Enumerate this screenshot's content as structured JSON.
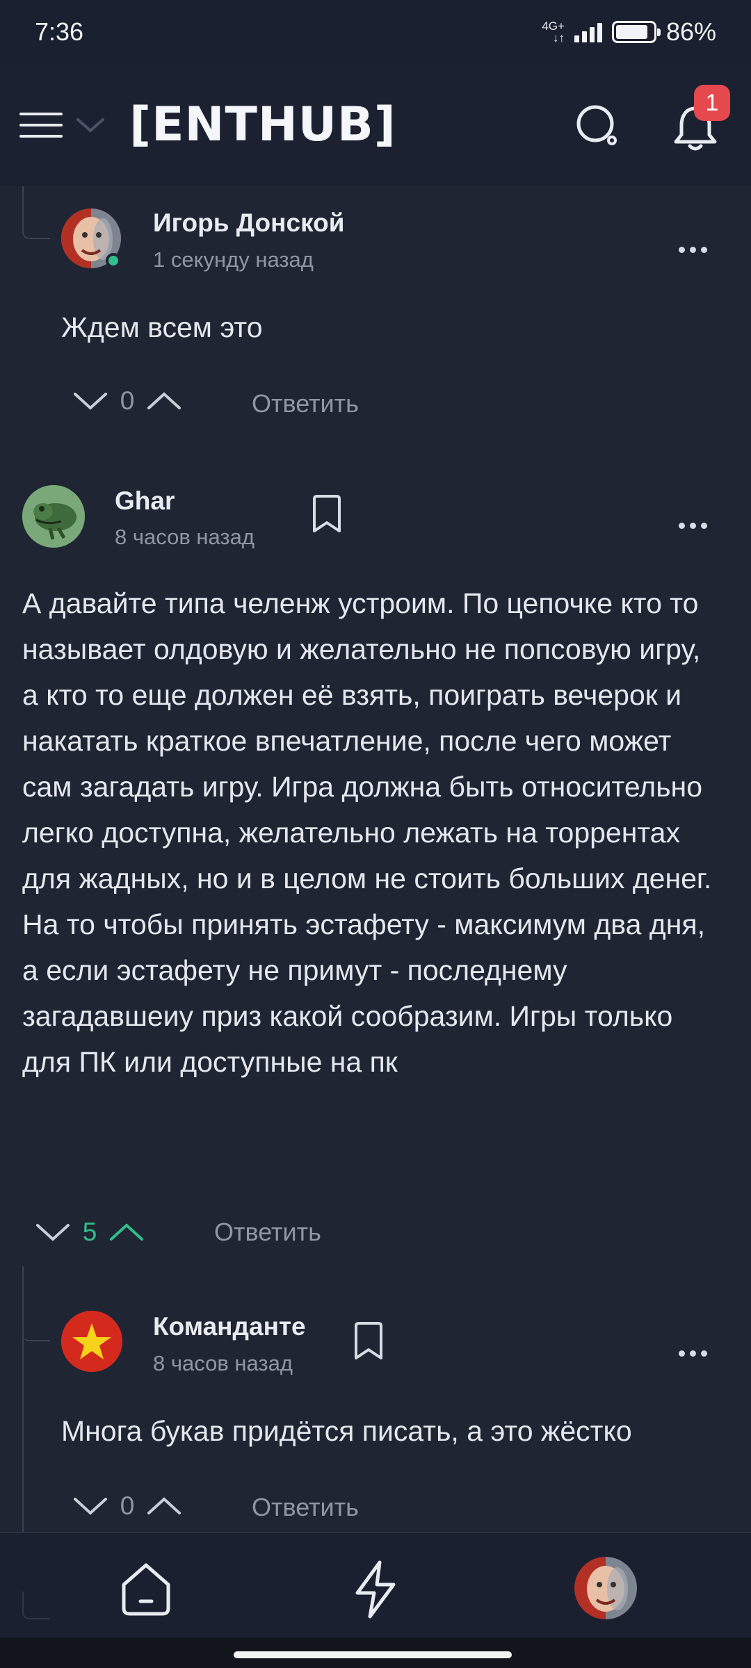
{
  "status": {
    "time": "7:36",
    "network_top": "4G+",
    "network_bottom": "↓↑",
    "battery_percent": "86%",
    "battery_level": 0.86
  },
  "header": {
    "brand": "[ENTHUB]",
    "notification_count": "1"
  },
  "comments": [
    {
      "author": "Игорь Донской",
      "time": "1 секунду назад",
      "text": "Ждем всем это",
      "votes": "0",
      "reply_label": "Ответить"
    },
    {
      "author": "Ghar",
      "time": "8 часов назад",
      "text": "А давайте типа челенж устроим. По цепочке кто то называет олдовую и желательно не попсовую игру, а кто то еще должен её взять, поиграть вечерок и накатать краткое впечатление, после чего может сам загадать игру. Игра должна быть относительно легко доступна, желательно лежать на торрентах для жадных, но и в целом не стоить больших денег. На то чтобы принять эстафету - максимум два дня, а если эстафету не примут - последнему загадавшеиу приз какой сообразим. Игры только для ПК или доступные на пк",
      "votes": "5",
      "reply_label": "Ответить"
    },
    {
      "author": "Команданте",
      "time": "8 часов назад",
      "text": "Многа букав придётся писать, а это жёстко",
      "votes": "0",
      "reply_label": "Ответить"
    }
  ],
  "colors": {
    "accent_green": "#2fbf8a",
    "badge_red": "#e5484d",
    "background": "#1f2533"
  },
  "icons": [
    "menu-icon",
    "chevron-down-icon",
    "search-icon",
    "bell-icon",
    "more-icon",
    "bookmark-icon",
    "downvote-icon",
    "upvote-icon",
    "home-icon",
    "lightning-icon",
    "profile-avatar"
  ]
}
